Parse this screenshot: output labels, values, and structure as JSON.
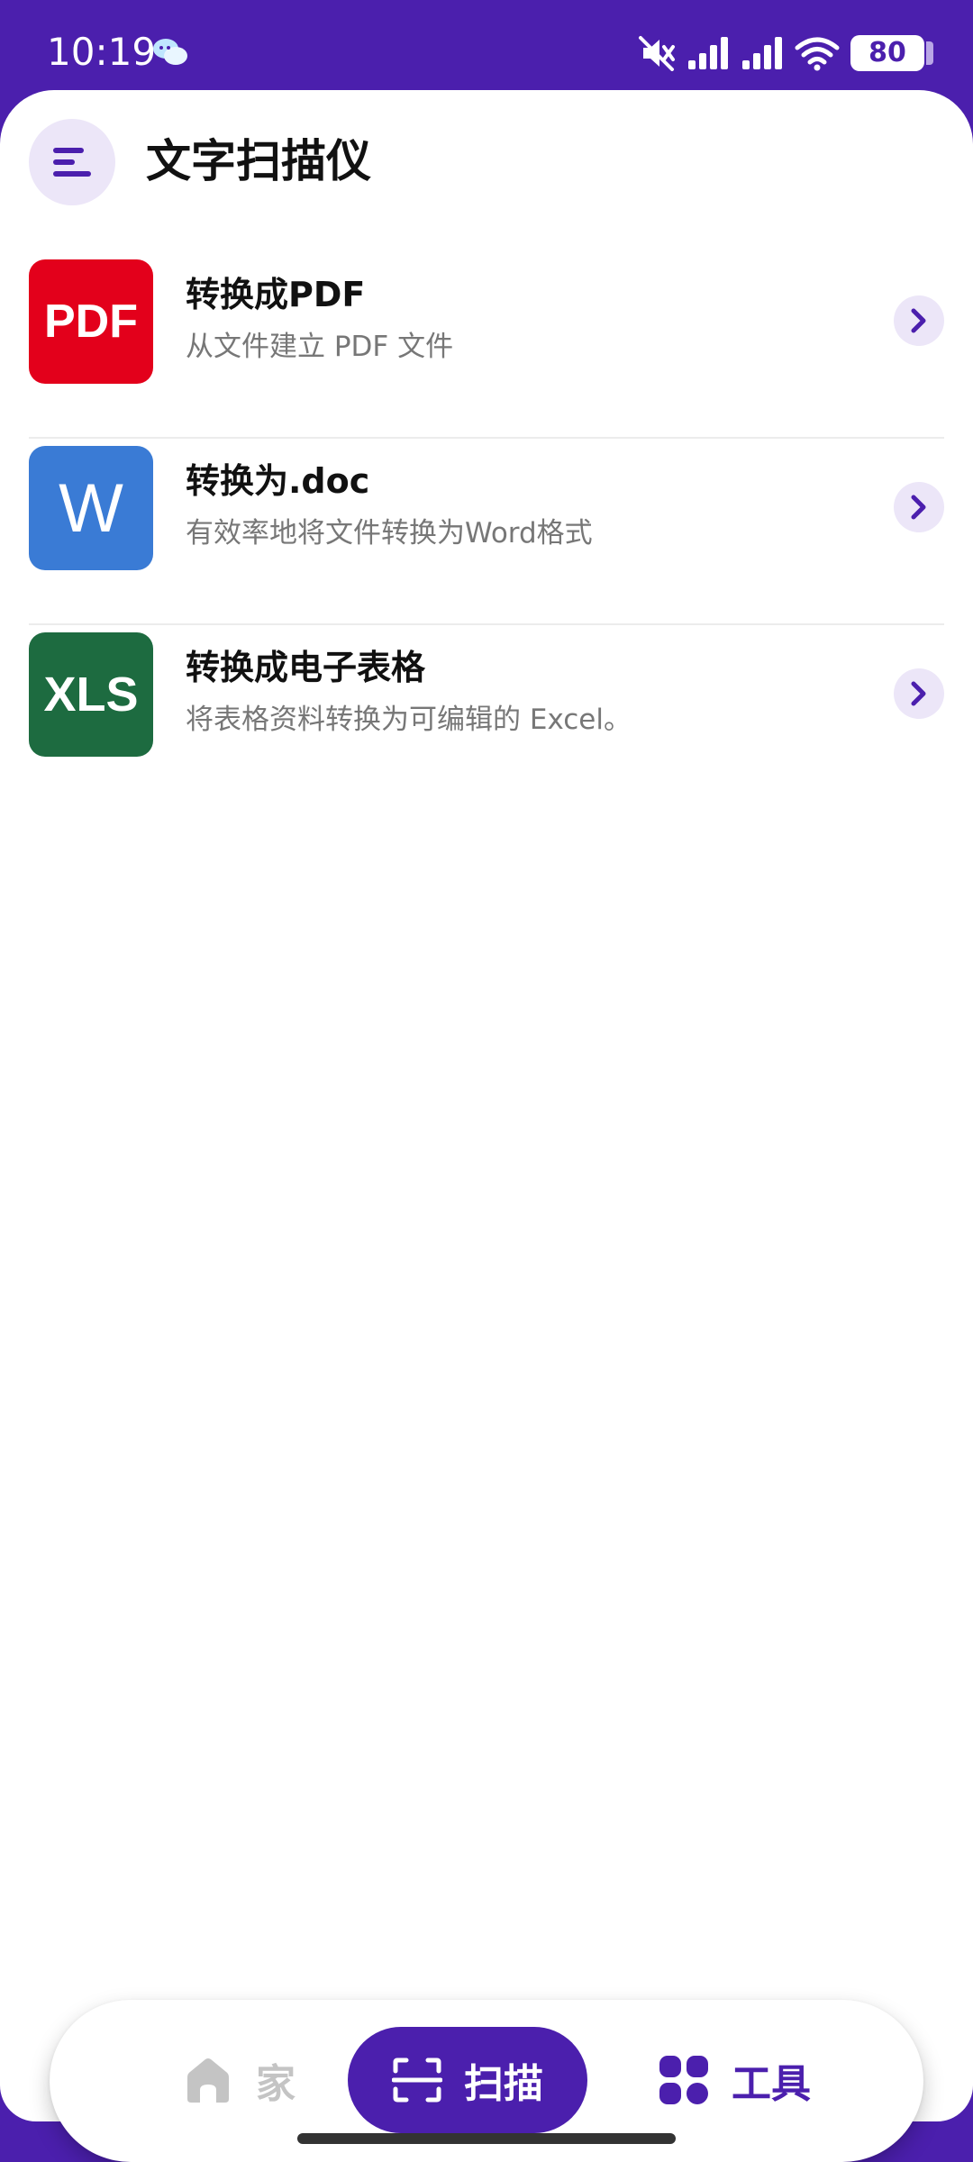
{
  "status_bar": {
    "time": "10:19",
    "notification_icon": "chat-bubbles-icon",
    "icons": [
      "muted-icon",
      "signal-icon",
      "signal-icon",
      "wifi-icon"
    ],
    "battery_level": "80"
  },
  "header": {
    "menu_icon": "menu-icon",
    "title": "文字扫描仪"
  },
  "tools": [
    {
      "logo_text": "PDF",
      "logo_color": "#e3001b",
      "title": "转换成PDF",
      "description": "从文件建立 PDF 文件"
    },
    {
      "logo_text": "W",
      "logo_color": "#3a7bd5",
      "title": "转换为.doc",
      "description": "有效率地将文件转换为Word格式"
    },
    {
      "logo_text": "XLS",
      "logo_color": "#1d6b40",
      "title": "转换成电子表格",
      "description": "将表格资料转换为可编辑的 Excel。"
    }
  ],
  "bottom_nav": {
    "home_label": "家",
    "scan_label": "扫描",
    "tools_label": "工具",
    "active": "scan"
  },
  "colors": {
    "accent": "#4b1fad",
    "accent_light": "#ece6f8",
    "inactive": "#c4c4c4"
  }
}
